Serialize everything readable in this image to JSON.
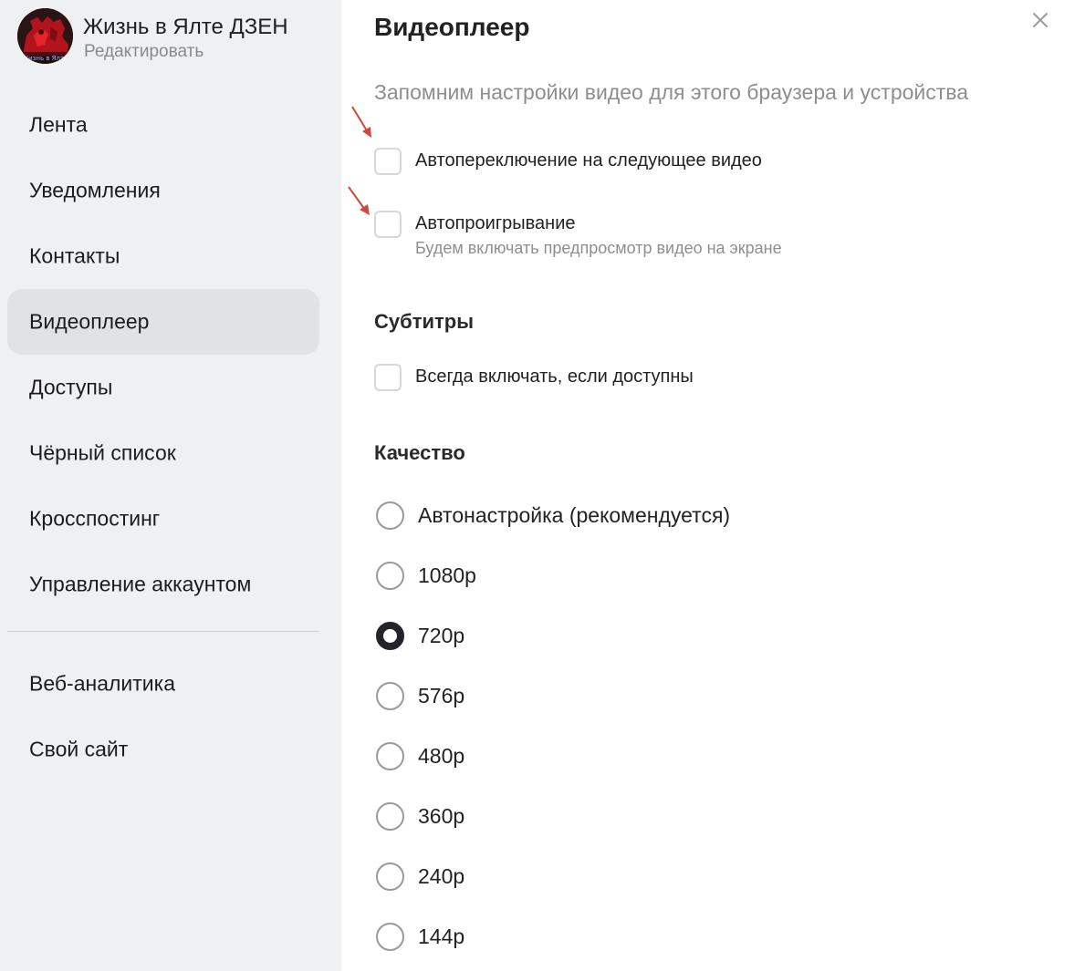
{
  "profile": {
    "name": "Жизнь в Ялте ДЗЕН",
    "edit_label": "Редактировать",
    "avatar_caption": "Жизнь в Ялте"
  },
  "sidebar": {
    "items": [
      {
        "label": "Лента"
      },
      {
        "label": "Уведомления"
      },
      {
        "label": "Контакты"
      },
      {
        "label": "Видеоплеер",
        "active": true
      },
      {
        "label": "Доступы"
      },
      {
        "label": "Чёрный список"
      },
      {
        "label": "Кросспостинг"
      },
      {
        "label": "Управление аккаунтом"
      }
    ],
    "extra_items": [
      {
        "label": "Веб-аналитика"
      },
      {
        "label": "Свой сайт"
      }
    ]
  },
  "main": {
    "title": "Видеоплеер",
    "subtitle": "Запомним настройки видео для этого браузера и устройства",
    "autoplay_options": [
      {
        "label": "Автопереключение на следующее видео",
        "checked": false
      },
      {
        "label": "Автопроигрывание",
        "hint": "Будем включать предпросмотр видео на экране",
        "checked": false
      }
    ],
    "subtitles": {
      "title": "Субтитры",
      "option": {
        "label": "Всегда включать, если доступны",
        "checked": false
      }
    },
    "quality": {
      "title": "Качество",
      "selected": "720p",
      "options": [
        {
          "label": "Автонастройка (рекомендуется)"
        },
        {
          "label": "1080p"
        },
        {
          "label": "720p"
        },
        {
          "label": "576p"
        },
        {
          "label": "480p"
        },
        {
          "label": "360p"
        },
        {
          "label": "240p"
        },
        {
          "label": "144p"
        }
      ]
    }
  },
  "icons": {
    "close": "close-icon",
    "annotation_arrow": "arrow-annotation-icon"
  },
  "colors": {
    "sidebar_bg": "#eff0f2",
    "active_item_bg": "#e1e2e5",
    "radio_selected": "#222429",
    "annotation_arrow": "#d0483c"
  }
}
